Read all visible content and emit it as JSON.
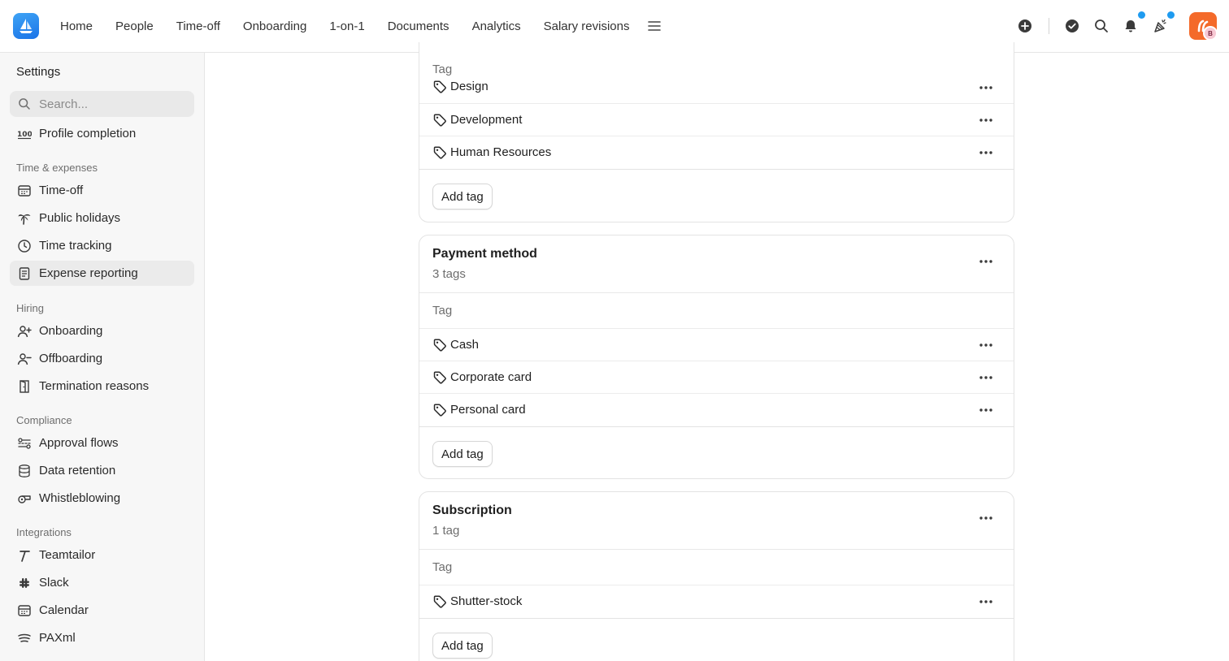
{
  "topbar": {
    "nav": [
      "Home",
      "People",
      "Time-off",
      "Onboarding",
      "1-on-1",
      "Documents",
      "Analytics",
      "Salary revisions"
    ],
    "avatar_badge": "B",
    "brand_color": "#1a73e8",
    "notification_dot_color": "#1e9bf0",
    "avatar_color": "#f46a2a"
  },
  "sidebar": {
    "title": "Settings",
    "search_placeholder": "Search...",
    "profile_completion": "Profile completion",
    "sections": {
      "time": "Time & expenses",
      "hiring": "Hiring",
      "compliance": "Compliance",
      "integrations": "Integrations"
    },
    "items": {
      "time_off": "Time-off",
      "public_holidays": "Public holidays",
      "time_tracking": "Time tracking",
      "expense_reporting": "Expense reporting",
      "onboarding": "Onboarding",
      "offboarding": "Offboarding",
      "termination_reasons": "Termination reasons",
      "approval_flows": "Approval flows",
      "data_retention": "Data retention",
      "whistleblowing": "Whistleblowing",
      "teamtailor": "Teamtailor",
      "slack": "Slack",
      "calendar": "Calendar",
      "paxml": "PAXml"
    }
  },
  "cards": {
    "first": {
      "col_header": "Tag",
      "tags": [
        "Design",
        "Development",
        "Human Resources"
      ],
      "add_label": "Add tag"
    },
    "payment": {
      "title": "Payment method",
      "count": "3 tags",
      "col_header": "Tag",
      "tags": [
        "Cash",
        "Corporate card",
        "Personal card"
      ],
      "add_label": "Add tag"
    },
    "subscription": {
      "title": "Subscription",
      "count": "1 tag",
      "col_header": "Tag",
      "tags": [
        "Shutter-stock"
      ],
      "add_label": "Add tag"
    }
  }
}
